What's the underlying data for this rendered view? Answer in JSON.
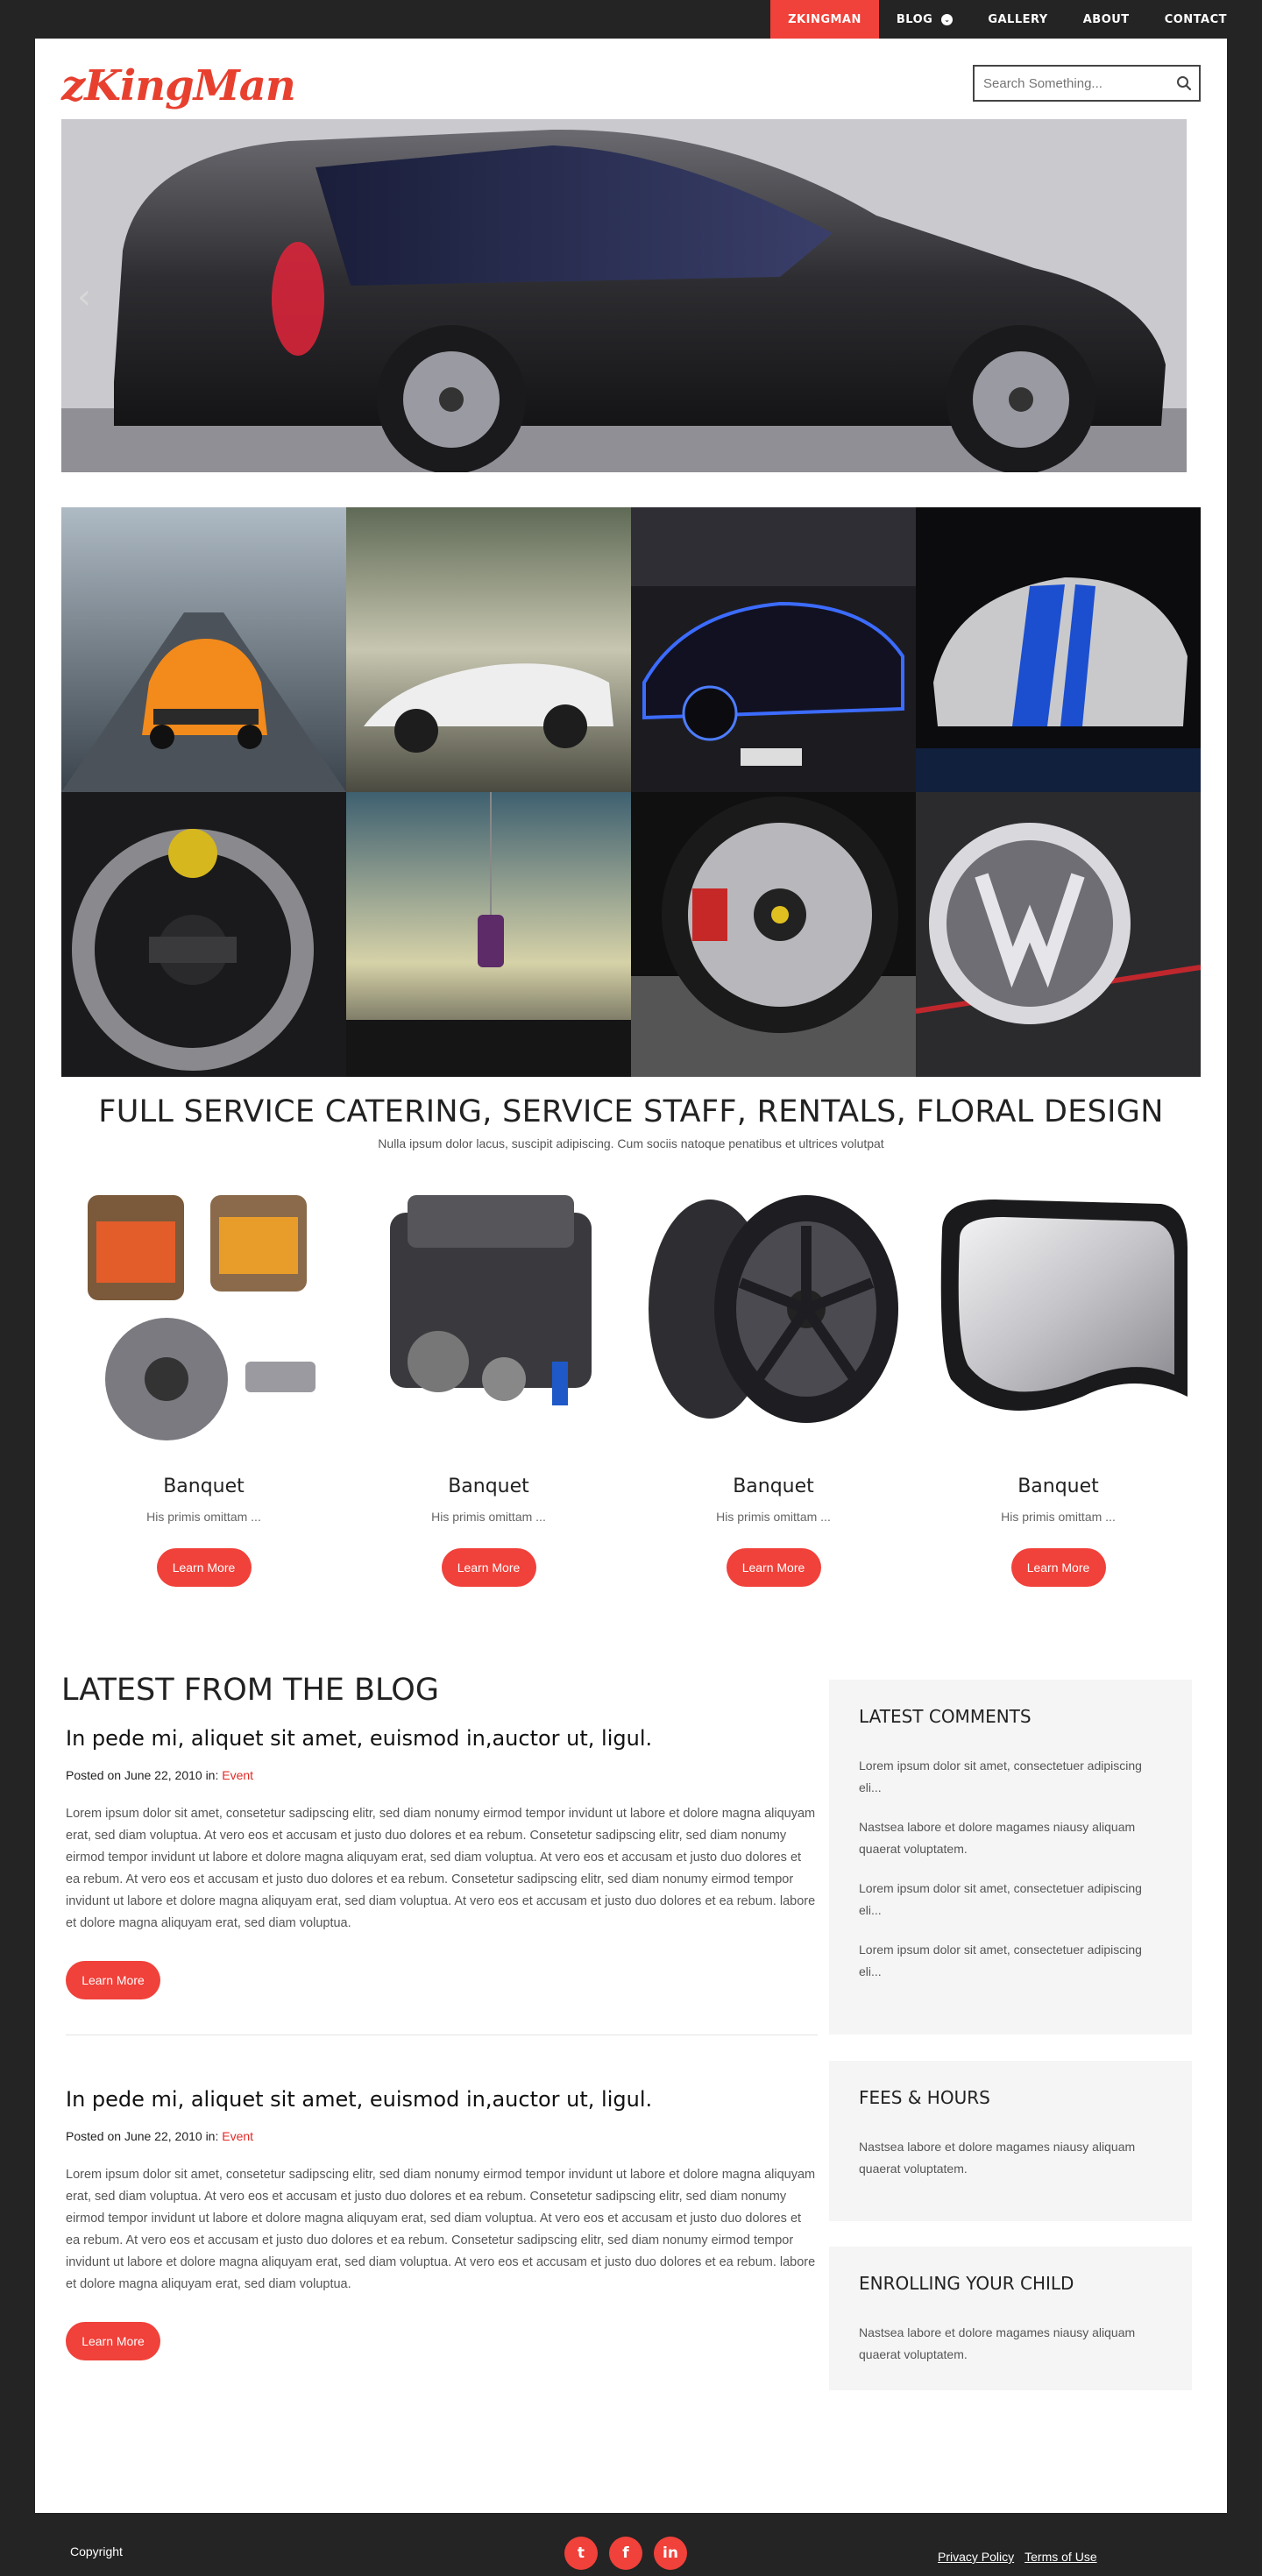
{
  "nav": {
    "items": [
      {
        "label": "ZKINGMAN"
      },
      {
        "label": "BLOG"
      },
      {
        "label": "GALLERY"
      },
      {
        "label": "ABOUT"
      },
      {
        "label": "CONTACT"
      }
    ],
    "dropdown_glyph": "⌄"
  },
  "header": {
    "logo": "zKingMan",
    "search_placeholder": "Search Something..."
  },
  "slider": {
    "prev": "‹",
    "next": "›"
  },
  "banner": {
    "title": "FULL SERVICE CATERING, SERVICE STAFF, RENTALS, FLORAL DESIGN",
    "subtitle": "Nulla ipsum dolor lacus, suscipit adipiscing. Cum sociis natoque penatibus et ultrices volutpat"
  },
  "features": [
    {
      "title": "Banquet",
      "text": "His primis omittam ...",
      "button": "Learn More"
    },
    {
      "title": "Banquet",
      "text": "His primis omittam ...",
      "button": "Learn More"
    },
    {
      "title": "Banquet",
      "text": "His primis omittam ...",
      "button": "Learn More"
    },
    {
      "title": "Banquet",
      "text": "His primis omittam ...",
      "button": "Learn More"
    }
  ],
  "blog": {
    "heading": "LATEST FROM THE BLOG",
    "posts": [
      {
        "title": "In pede mi, aliquet sit amet, euismod in,auctor ut, ligul.",
        "meta_prefix": "Posted on June 22, 2010 in: ",
        "category": "Event",
        "body": "Lorem ipsum dolor sit amet, consetetur sadipscing elitr, sed diam nonumy eirmod tempor invidunt ut labore et dolore magna aliquyam erat, sed diam voluptua. At vero eos et accusam et justo duo dolores et ea rebum. Consetetur sadipscing elitr, sed diam nonumy eirmod tempor invidunt ut labore et dolore magna aliquyam erat, sed diam voluptua. At vero eos et accusam et justo duo dolores et ea rebum. At vero eos et accusam et justo duo dolores et ea rebum. Consetetur sadipscing elitr, sed diam nonumy eirmod tempor invidunt ut labore et dolore magna aliquyam erat, sed diam voluptua. At vero eos et accusam et justo duo dolores et ea rebum. labore et dolore magna aliquyam erat, sed diam voluptua.",
        "button": "Learn More"
      },
      {
        "title": "In pede mi, aliquet sit amet, euismod in,auctor ut, ligul.",
        "meta_prefix": "Posted on June 22, 2010 in: ",
        "category": "Event",
        "body": "Lorem ipsum dolor sit amet, consetetur sadipscing elitr, sed diam nonumy eirmod tempor invidunt ut labore et dolore magna aliquyam erat, sed diam voluptua. At vero eos et accusam et justo duo dolores et ea rebum. Consetetur sadipscing elitr, sed diam nonumy eirmod tempor invidunt ut labore et dolore magna aliquyam erat, sed diam voluptua. At vero eos et accusam et justo duo dolores et ea rebum. At vero eos et accusam et justo duo dolores et ea rebum. Consetetur sadipscing elitr, sed diam nonumy eirmod tempor invidunt ut labore et dolore magna aliquyam erat, sed diam voluptua. At vero eos et accusam et justo duo dolores et ea rebum. labore et dolore magna aliquyam erat, sed diam voluptua.",
        "button": "Learn More"
      }
    ]
  },
  "sidebar": {
    "comments": {
      "title": "LATEST COMMENTS",
      "items": [
        "Lorem ipsum dolor sit amet, consectetuer adipiscing eli...",
        "Nastsea labore et dolore magames niausy aliquam quaerat voluptatem.",
        "Lorem ipsum dolor sit amet, consectetuer adipiscing eli...",
        "Lorem ipsum dolor sit amet, consectetuer adipiscing eli..."
      ]
    },
    "fees": {
      "title": "FEES & HOURS",
      "text": "Nastsea labore et dolore magames niausy aliquam quaerat voluptatem."
    },
    "enroll": {
      "title": "ENROLLING YOUR CHILD",
      "text": "Nastsea labore et dolore magames niausy aliquam quaerat voluptatem."
    }
  },
  "footer": {
    "copyright": "Copyright",
    "social": [
      {
        "icon": "twitter-icon",
        "glyph": "t"
      },
      {
        "icon": "facebook-icon",
        "glyph": "f"
      },
      {
        "icon": "linkedin-icon",
        "glyph": "in"
      }
    ],
    "links": [
      "Privacy Policy",
      "Terms of Use"
    ]
  },
  "colors": {
    "accent": "#f0413a",
    "background": "#242424",
    "page": "#ffffff",
    "sidebar_bg": "#f5f5f5"
  }
}
